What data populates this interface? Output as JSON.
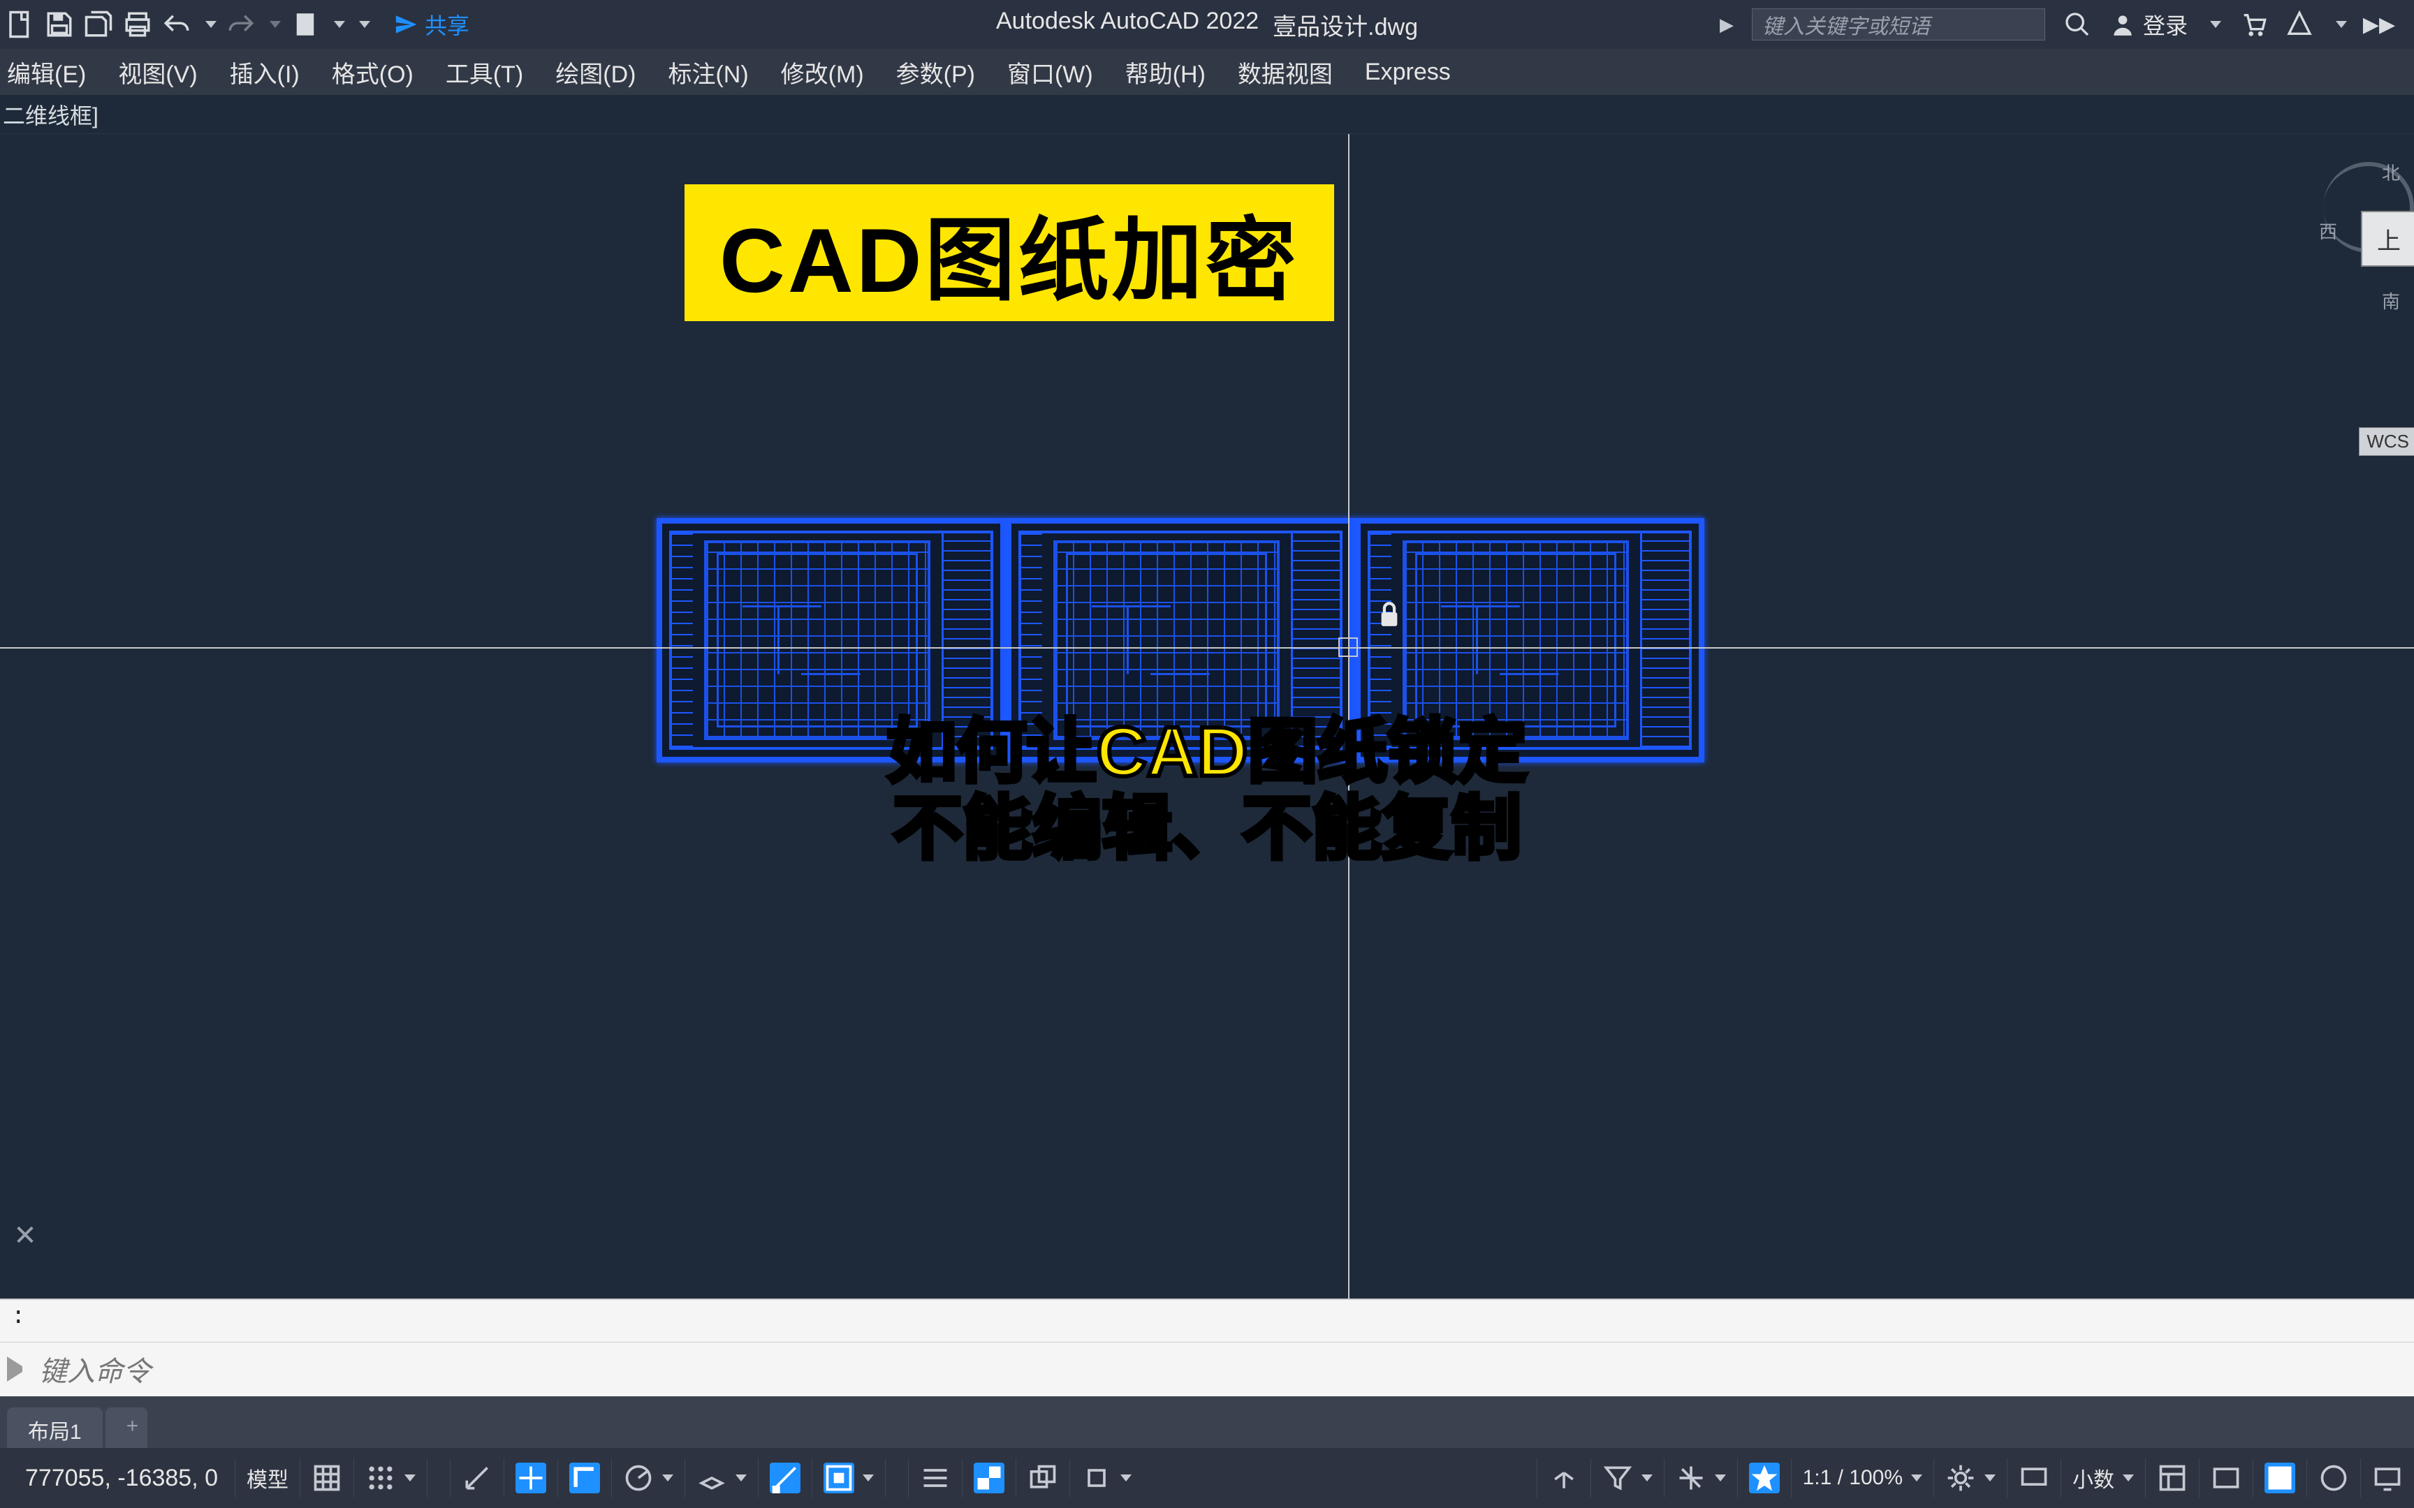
{
  "titlebar": {
    "app": "Autodesk AutoCAD 2022",
    "doc": "壹品设计.dwg",
    "share": "共享",
    "search_placeholder": "键入关键字或短语",
    "login": "登录"
  },
  "menu": [
    "编辑(E)",
    "视图(V)",
    "插入(I)",
    "格式(O)",
    "工具(T)",
    "绘图(D)",
    "标注(N)",
    "修改(M)",
    "参数(P)",
    "窗口(W)",
    "帮助(H)",
    "数据视图",
    "Express"
  ],
  "sub_label": "二维线框]",
  "overlay": {
    "headline": "CAD图纸加密",
    "subtitle_l1": "如何让CAD图纸锁定",
    "subtitle_l2": "不能编辑、不能复制"
  },
  "viewcube": {
    "n": "北",
    "w": "西",
    "s": "南",
    "top": "上",
    "wcs": "WCS"
  },
  "cmd": {
    "hist": ":",
    "placeholder": "键入命令"
  },
  "layout_tabs": [
    "布局1"
  ],
  "status": {
    "coords": "777055, -16385, 0",
    "space": "模型",
    "scale": "1:1 / 100%",
    "units": "小数"
  }
}
